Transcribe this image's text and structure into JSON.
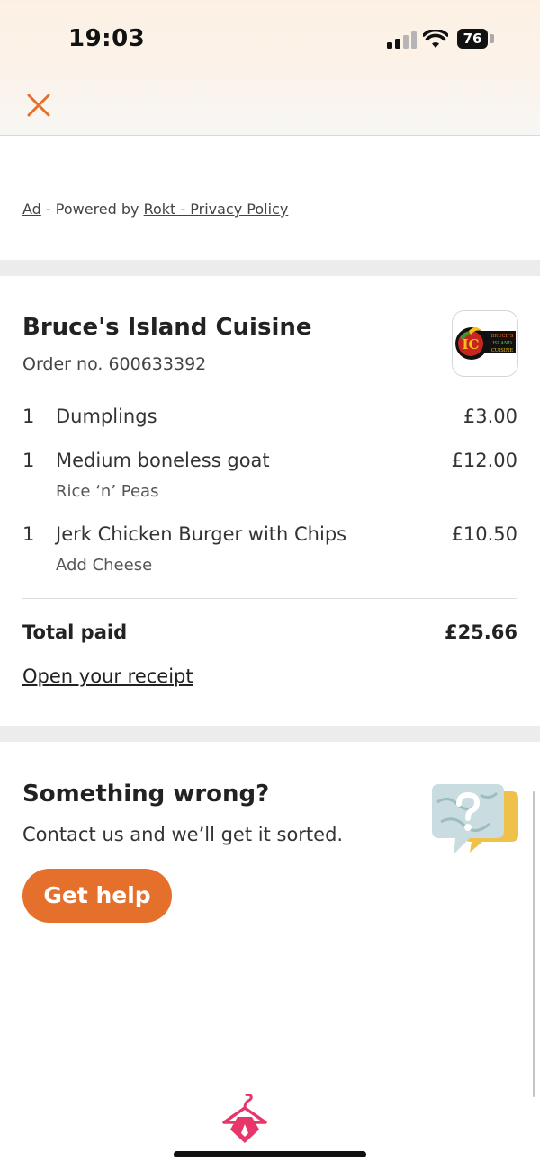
{
  "status_bar": {
    "time": "19:03",
    "battery": "76"
  },
  "ad": {
    "ad_label": "Ad",
    "powered_by": " - Powered by ",
    "provider_link": "Rokt - Privacy Policy"
  },
  "order": {
    "restaurant_name": "Bruce's Island Cuisine",
    "order_number": "Order no. 600633392",
    "logo_text": {
      "initials": "IC",
      "line1": "BRUCE'S",
      "line2": "ISLAND",
      "line3": "CUISINE"
    },
    "items": [
      {
        "qty": "1",
        "name": "Dumplings",
        "price": "£3.00",
        "modifier": ""
      },
      {
        "qty": "1",
        "name": "Medium boneless goat",
        "price": "£12.00",
        "modifier": "Rice ‘n’ Peas"
      },
      {
        "qty": "1",
        "name": "Jerk Chicken Burger with Chips",
        "price": "£10.50",
        "modifier": "Add Cheese"
      }
    ],
    "total_label": "Total paid",
    "total_value": "£25.66",
    "receipt_link": "Open your receipt"
  },
  "help": {
    "title": "Something wrong?",
    "subtitle": "Contact us and we’ll get it sorted.",
    "button_label": "Get help"
  },
  "colors": {
    "accent": "#e5702c",
    "brand_pink": "#e8366b",
    "divider": "#ececec"
  },
  "icons": {
    "close": "close-icon",
    "help_illustration": "question-bubble-icon",
    "brand": "deliveroo-hanger-logo-icon"
  }
}
